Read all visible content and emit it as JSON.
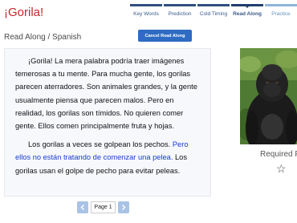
{
  "header": {
    "title": "¡Gorila!"
  },
  "steps": [
    {
      "label": "Key Words"
    },
    {
      "label": "Prediction"
    },
    {
      "label": "Cold Timing"
    },
    {
      "label": "Read Along"
    },
    {
      "label": "Practice"
    }
  ],
  "mode": {
    "label": "Read Along / Spanish",
    "cancel_label": "Cancel Read Along"
  },
  "passage": {
    "p1": "¡Gorila! La mera palabra podría traer imágenes temerosas a tu mente. Para mucha gente, los gorilas parecen aterradores. Son animales grandes, y la gente usualmente piensa que parecen malos. Pero en realidad, los gorilas son tímidos. No quieren comer gente. Ellos comen principalmente fruta y hojas.",
    "p2_start": "Los gorilas a veces se golpean los pechos. ",
    "p2_highlight": "Pero ellos no están tratando de comenzar una pelea.",
    "p2_end": " Los gorilas usan el golpe de pecho para evitar peleas."
  },
  "sidebar": {
    "required_label": "Required F"
  },
  "pager": {
    "page_label": "Page 1"
  },
  "colors": {
    "title": "#c0282a",
    "button": "#2e6bc2",
    "highlight": "#1a3ccf"
  }
}
